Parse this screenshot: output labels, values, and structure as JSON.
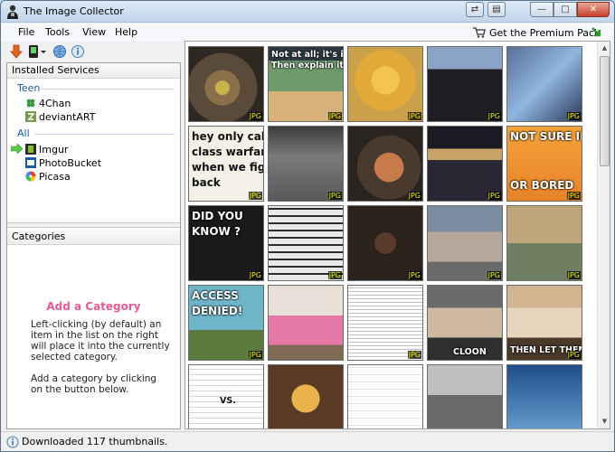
{
  "window": {
    "title": "The Image Collector"
  },
  "menu": {
    "file": "File",
    "tools": "Tools",
    "view": "View",
    "help": "Help",
    "premium": "Get the Premium Pack"
  },
  "left": {
    "services_header": "Installed Services",
    "groups": [
      {
        "label": "Teen",
        "services": [
          "4Chan",
          "deviantART"
        ]
      },
      {
        "label": "All",
        "services": [
          "Imgur",
          "PhotoBucket",
          "Picasa"
        ]
      }
    ],
    "categories_header": "Categories",
    "add_category": {
      "title": "Add a Category",
      "text1": "Left-clicking (by default) an item in the list on the right will place it into the currently selected category.",
      "text2": "Add a category by clicking on the button below."
    }
  },
  "grid": {
    "badge": "JPG",
    "thumbs": [
      {
        "caption": ""
      },
      {
        "caption": "Not at all; it's incredibly simple.|Then explain it."
      },
      {
        "caption": ""
      },
      {
        "caption": ""
      },
      {
        "caption": ""
      },
      {
        "caption": "hey only call|class warfare|when we fight|back"
      },
      {
        "caption": ""
      },
      {
        "caption": ""
      },
      {
        "caption": ""
      },
      {
        "caption": "NOT SURE IF HUNGRY|OR BORED"
      },
      {
        "caption": "DID YOU|KNOW ?"
      },
      {
        "caption": ""
      },
      {
        "caption": ""
      },
      {
        "caption": ""
      },
      {
        "caption": ""
      },
      {
        "caption": "ACCESS|DENIED!"
      },
      {
        "caption": ""
      },
      {
        "caption": ""
      },
      {
        "caption": "CLOON"
      },
      {
        "caption": "THEN LET THEM"
      },
      {
        "caption": "VS."
      },
      {
        "caption": ""
      },
      {
        "caption": ""
      },
      {
        "caption": ""
      },
      {
        "caption": ""
      }
    ]
  },
  "status": {
    "text": "Downloaded 117 thumbnails."
  },
  "colors": {
    "accent": "#1f5ba8",
    "add_category": "#e85a98",
    "badge": "#f4f400"
  }
}
